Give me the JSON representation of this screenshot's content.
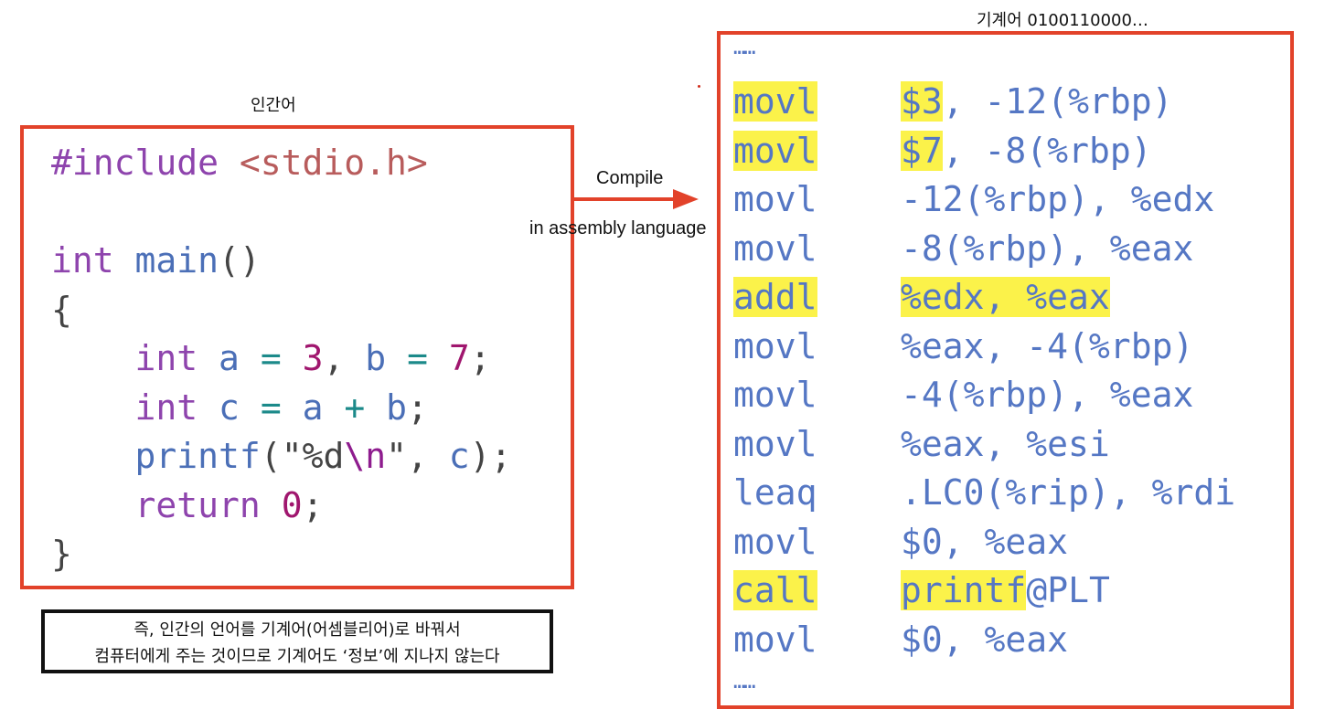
{
  "labels": {
    "human": "인간어",
    "machine": "기계어 0100110000…",
    "compile": "Compile",
    "assembly": "in assembly language"
  },
  "c_code": {
    "line1_a": "#include ",
    "line1_b": "<stdio.h>",
    "line2_kw": "int",
    "line2_fn": "main",
    "line2_rest": "()",
    "line3": "{",
    "line4_kw": "int",
    "line4_a": "a",
    "line4_eq1": "=",
    "line4_3": "3",
    "line4_b": "b",
    "line4_eq2": "=",
    "line4_7": "7",
    "line5_kw": "int",
    "line5_c": "c",
    "line5_eq": "=",
    "line5_a": "a",
    "line5_plus": "+",
    "line5_b": "b",
    "line6_fn": "printf",
    "line6_fmt": "\"%d",
    "line6_esc": "\\n",
    "line6_q": "\"",
    "line6_c": "c",
    "line7_kw": "return",
    "line7_0": "0",
    "line8": "}"
  },
  "asm": {
    "dots": "……",
    "lines": [
      {
        "op": "movl",
        "args": "$3, -12(%rbp)"
      },
      {
        "op": "movl",
        "args": "$7, -8(%rbp)"
      },
      {
        "op": "movl",
        "args": "-12(%rbp), %edx"
      },
      {
        "op": "movl",
        "args": "-8(%rbp), %eax"
      },
      {
        "op": "addl",
        "args": "%edx, %eax"
      },
      {
        "op": "movl",
        "args": "%eax, -4(%rbp)"
      },
      {
        "op": "movl",
        "args": "-4(%rbp), %eax"
      },
      {
        "op": "movl",
        "args": "%eax, %esi"
      },
      {
        "op": "leaq",
        "args": ".LC0(%rip), %rdi"
      },
      {
        "op": "movl",
        "args": "$0, %eax"
      },
      {
        "op": "call",
        "args": "printf@PLT"
      },
      {
        "op": "movl",
        "args": "$0, %eax"
      }
    ],
    "highlights": {
      "line0_arg": "$3",
      "line1_arg": "$7",
      "line4_arg": "%edx, %eax",
      "line10_arg": "printf"
    }
  },
  "note": {
    "line1": "즉, 인간의 언어를 기계어(어셈블리어)로 바꿔서",
    "line2": "컴퓨터에게 주는 것이므로 기계어도 ‘정보’에 지나지 않는다"
  },
  "colors": {
    "box_border": "#e2422a",
    "highlight": "#fbf24a",
    "asm_text": "#5577c4"
  }
}
